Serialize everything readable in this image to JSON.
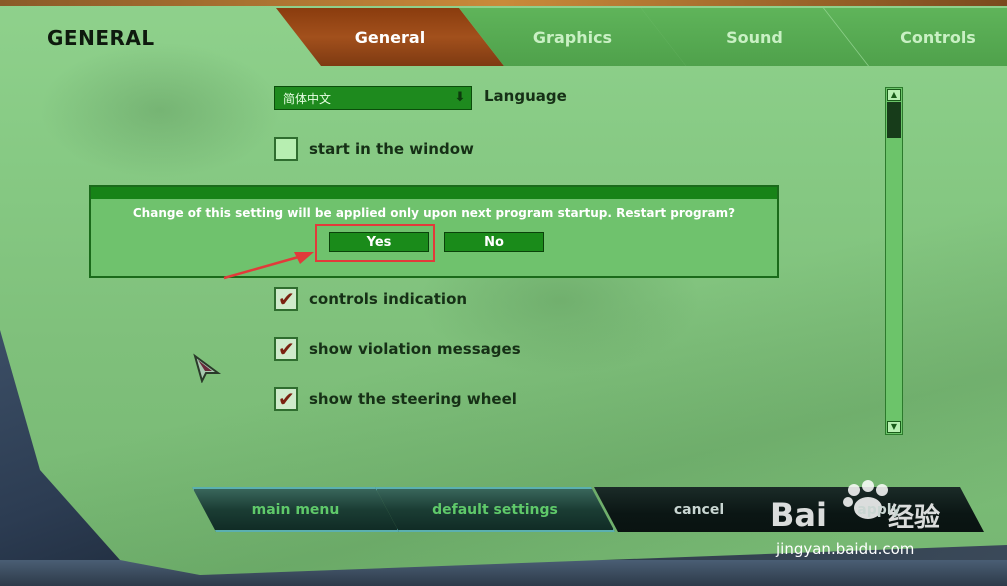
{
  "header": {
    "title": "GENERAL"
  },
  "tabs": [
    {
      "label": "General",
      "active": true
    },
    {
      "label": "Graphics",
      "active": false
    },
    {
      "label": "Sound",
      "active": false
    },
    {
      "label": "Controls",
      "active": false
    }
  ],
  "settings": {
    "language": {
      "value": "简体中文",
      "label": "Language"
    },
    "start_window": {
      "label": "start in the window",
      "checked": false
    },
    "controls_indication": {
      "label": "controls indication",
      "checked": true
    },
    "violation_messages": {
      "label": "show violation messages",
      "checked": true
    },
    "steering_wheel": {
      "label": "show the steering wheel",
      "checked": true
    }
  },
  "dialog": {
    "message": "Change of this setting will be applied only upon next program startup. Restart program?",
    "yes_label": "Yes",
    "no_label": "No"
  },
  "bottom_nav": {
    "main_menu": "main menu",
    "default_settings": "default settings",
    "cancel": "cancel",
    "apply": "apply"
  },
  "watermark": {
    "text": "jingyan.baidu.com"
  },
  "colors": {
    "panel_green": "#86c983",
    "active_tab": "#a2501c",
    "inactive_tab": "#5fb45a",
    "dialog_button": "#1a8b1a",
    "highlight": "#e23a3a",
    "checkmark": "#7a2010"
  },
  "icons": {
    "dropdown": "chevron-down-icon",
    "checkmark": "checkmark-icon",
    "scroll_up": "arrow-up-icon",
    "scroll_down": "arrow-down-icon",
    "cursor": "mouse-cursor-icon",
    "annotation_arrow": "red-arrow-icon"
  }
}
